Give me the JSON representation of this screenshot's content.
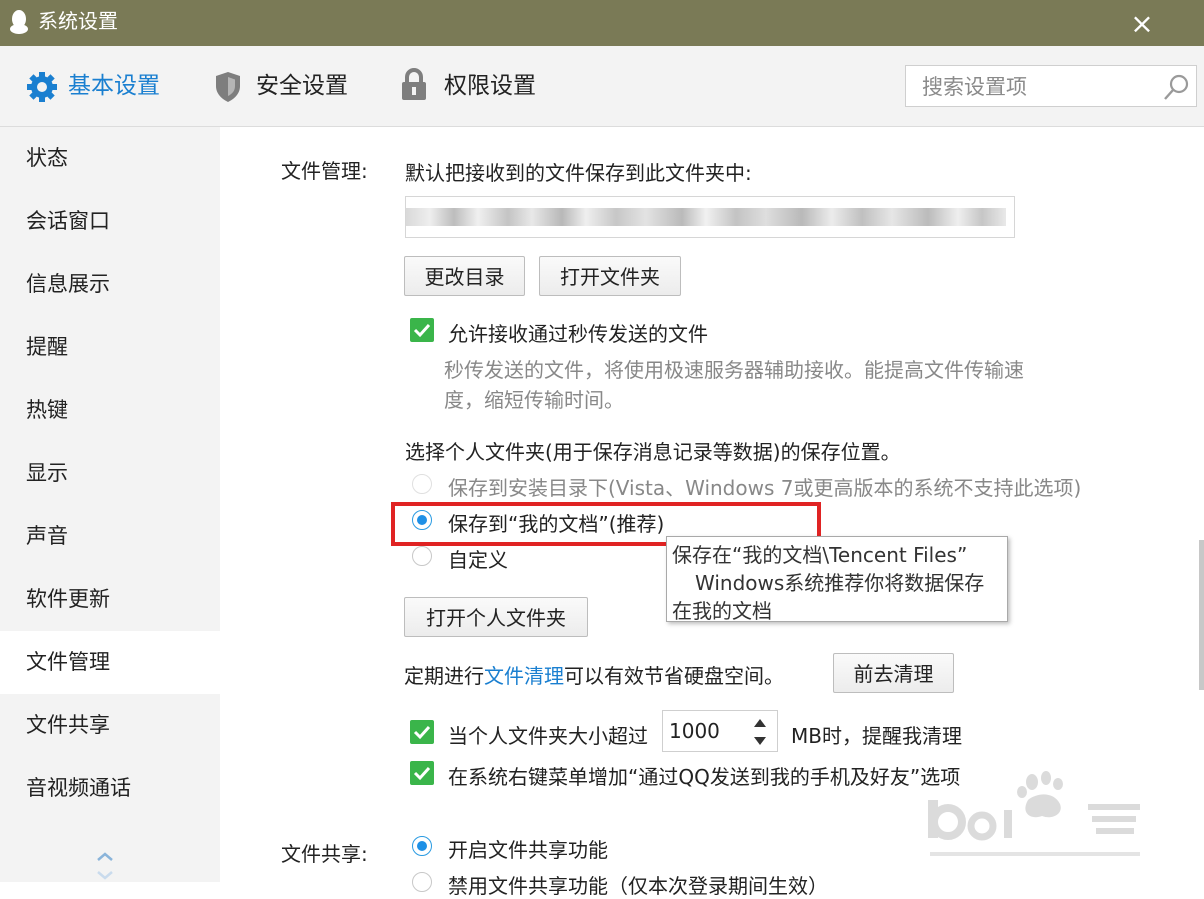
{
  "window": {
    "title": "系统设置",
    "close_glyph": "×"
  },
  "toolbar": {
    "tabs": [
      {
        "label": "基本设置",
        "icon": "gear-icon",
        "active": true
      },
      {
        "label": "安全设置",
        "icon": "shield-icon",
        "active": false
      },
      {
        "label": "权限设置",
        "icon": "lock-icon",
        "active": false
      }
    ],
    "search_placeholder": "搜索设置项"
  },
  "sidebar": {
    "items": [
      {
        "label": "状态"
      },
      {
        "label": "会话窗口"
      },
      {
        "label": "信息展示"
      },
      {
        "label": "提醒"
      },
      {
        "label": "热键"
      },
      {
        "label": "显示"
      },
      {
        "label": "声音"
      },
      {
        "label": "软件更新"
      },
      {
        "label": "文件管理",
        "active": true
      },
      {
        "label": "文件共享"
      },
      {
        "label": "音视频通话"
      }
    ]
  },
  "file_mgmt": {
    "section_label": "文件管理:",
    "save_desc": "默认把接收到的文件保存到此文件夹中:",
    "path_value": "",
    "change_dir_button": "更改目录",
    "open_folder_button": "打开文件夹",
    "allow_instant_label": "允许接收通过秒传发送的文件",
    "allow_instant_desc_1": "秒传发送的文件，将使用极速服务器辅助接收。能提高文件传输速",
    "allow_instant_desc_2": "度，缩短传输时间。",
    "personal_folder_title": "选择个人文件夹(用于保存消息记录等数据)的保存位置。",
    "radio_install": "保存到安装目录下(Vista、Windows 7或更高版本的系统不支持此选项)",
    "radio_mydocs": "保存到“我的文档”(推荐)",
    "radio_custom": "自定义",
    "tooltip_1": "保存在“我的文档\\Tencent Files”",
    "tooltip_2": "Windows系统推荐你将数据保存",
    "tooltip_3": "在我的文档",
    "open_personal_button": "打开个人文件夹",
    "cleanup_prefix": "定期进行",
    "cleanup_link": "文件清理",
    "cleanup_suffix": "可以有效节省硬盘空间。",
    "goto_cleanup_button": "前去清理",
    "size_warn_prefix": "当个人文件夹大小超过",
    "size_value": "1000",
    "size_warn_suffix": "MB时，提醒我清理",
    "context_menu_label": "在系统右键菜单增加“通过QQ发送到我的手机及好友”选项"
  },
  "file_share": {
    "section_label": "文件共享:",
    "enable_label": "开启文件共享功能",
    "disable_label": "禁用文件共享功能（仅本次登录期间生效）"
  },
  "colors": {
    "titlebar": "#7a7a56",
    "accent": "#1a7fd0",
    "check": "#3ab54a",
    "highlight": "#e02323"
  }
}
